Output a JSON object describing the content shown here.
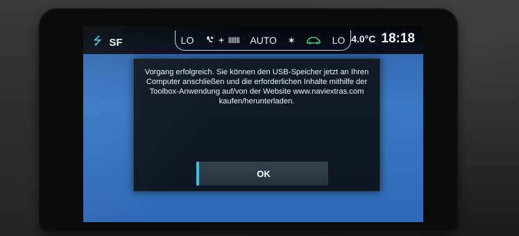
{
  "statusbar": {
    "usb_icon": "usb-icon",
    "source": "SF",
    "climate": {
      "left_temp": "LO",
      "mode_icon": "airflow-icon",
      "fan_icon": "fan-icon",
      "fan_bars": "IIIIIII",
      "auto_label": "AUTO",
      "sun_icon": "sun-icon",
      "car_icon": "recirculation-car-icon",
      "right_temp": "LO"
    },
    "outside_temp": "4.0°C",
    "time": "18:18"
  },
  "dialog": {
    "message": "Vorgang erfolgreich. Sie können den USB-Speicher jetzt an Ihren Computer anschließen und die erforderlichen Inhalte mithilfe der Toolbox-Anwendung auf/von der Website www.naviextras.com kaufen/herunterladen.",
    "ok_label": "OK"
  },
  "colors": {
    "screen_bg": "#3b78c4",
    "dialog_bg": "#121a24",
    "accent": "#37c3e0",
    "car_icon": "#30d07a"
  }
}
